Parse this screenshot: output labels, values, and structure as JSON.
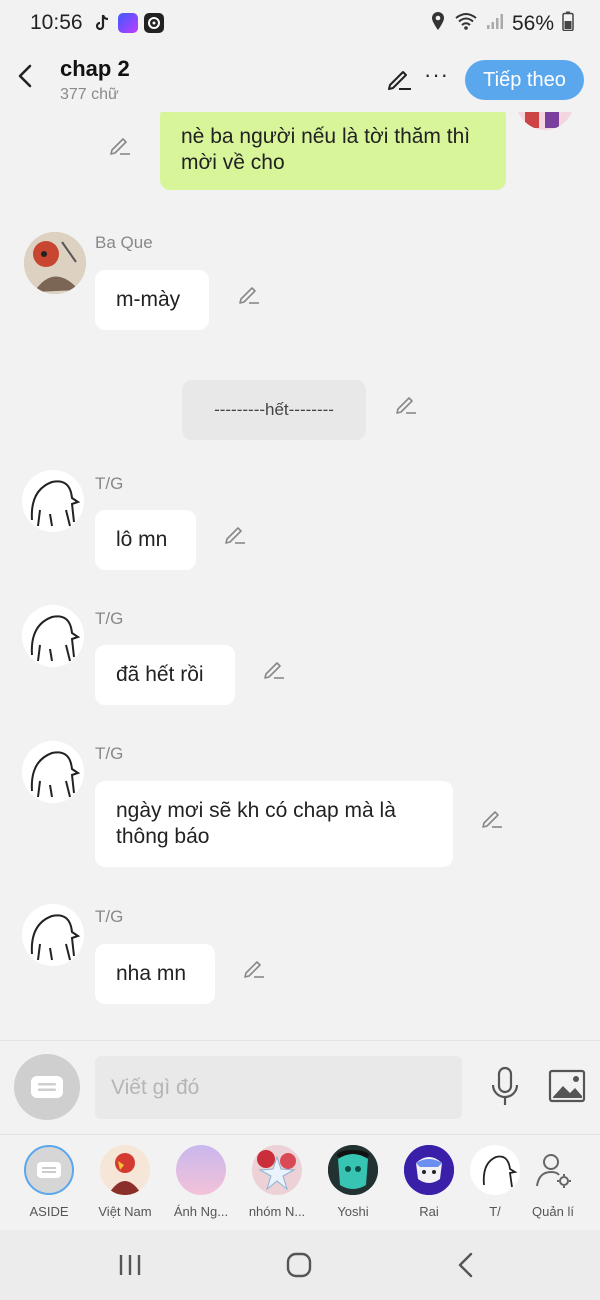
{
  "status": {
    "time": "10:56",
    "battery": "56%"
  },
  "header": {
    "title": "chap 2",
    "subtitle": "377 chữ",
    "next_label": "Tiếp theo",
    "more_label": "···"
  },
  "messages": {
    "green1": "nè ba người nếu là tời thăm thì mời về cho",
    "baque_name": "Ba Que",
    "baque_text": "m-mày",
    "divider": "---------hết--------",
    "tg1_name": "T/G",
    "tg1_text": "lô mn",
    "tg2_name": "T/G",
    "tg2_text": "đã hết rồi",
    "tg3_name": "T/G",
    "tg3_text": "ngày mơi sẽ kh có chap mà là thông báo",
    "tg4_name": "T/G",
    "tg4_text": "nha mn"
  },
  "input": {
    "placeholder": "Viết gì đó"
  },
  "characters": {
    "aside": "ASIDE",
    "vietnam": "Việt Nam",
    "anh": "Ánh Ng...",
    "nhom": "nhóm N...",
    "yoshi": "Yoshi",
    "rai": "Rai",
    "tg": "T/",
    "manage": "Quản lí"
  },
  "colors": {
    "accent": "#5aa7ee",
    "green_bubble": "#d8f59a",
    "background": "#f2f2f2"
  }
}
